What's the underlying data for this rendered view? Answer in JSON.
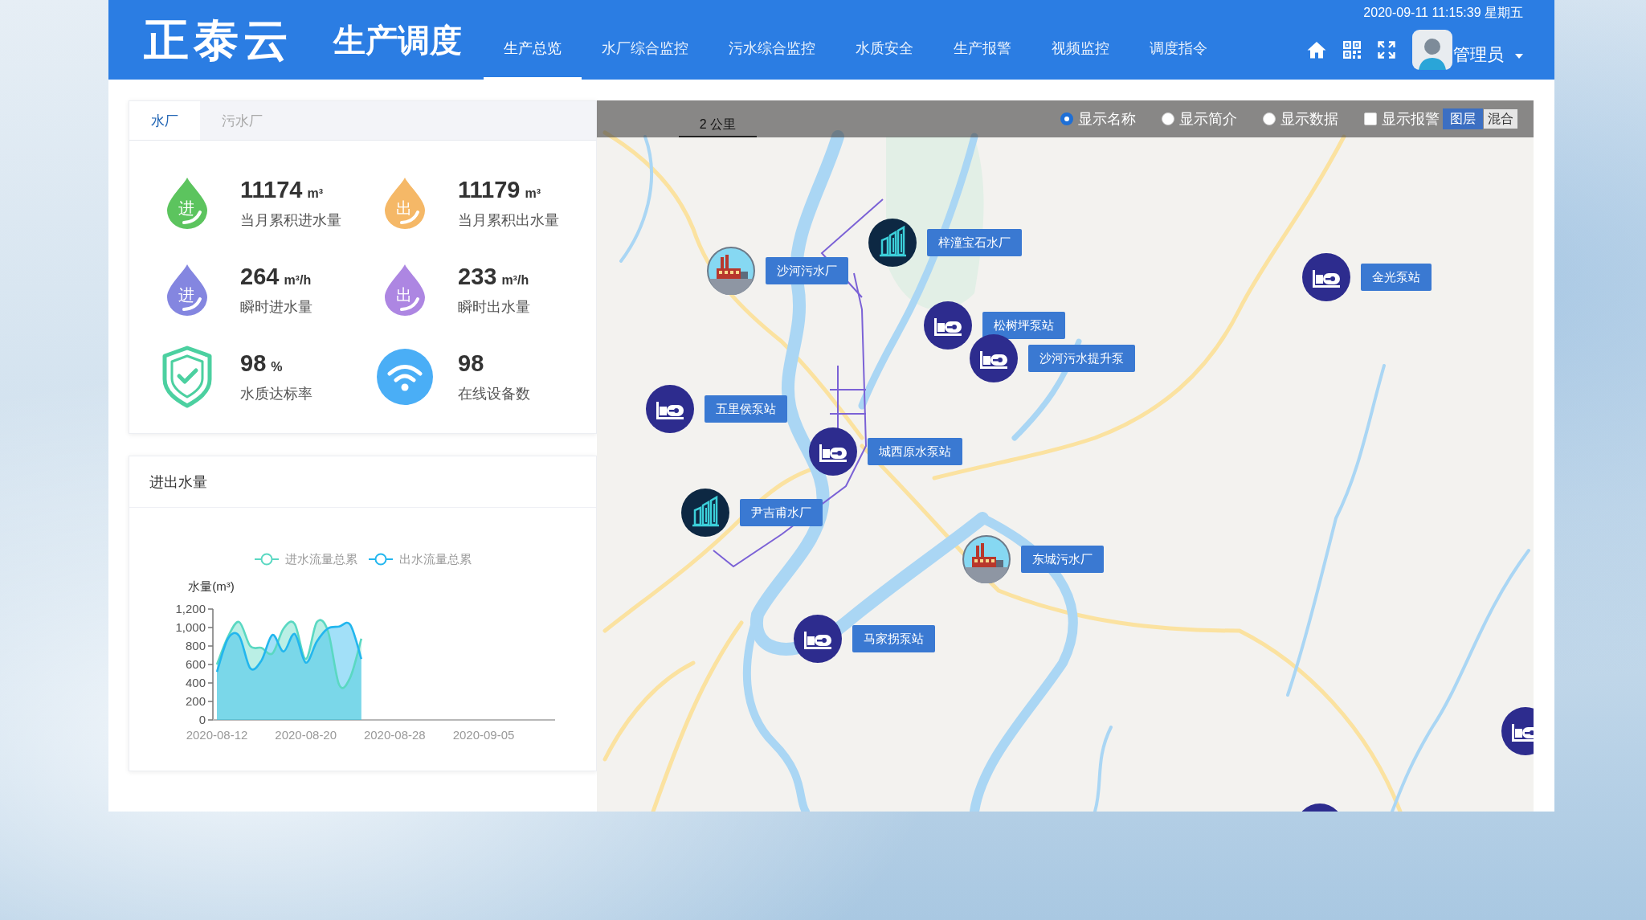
{
  "header": {
    "logo": "正泰云",
    "title": "生产调度",
    "nav": [
      {
        "label": "生产总览",
        "selected": true
      },
      {
        "label": "水厂综合监控",
        "selected": false
      },
      {
        "label": "污水综合监控",
        "selected": false
      },
      {
        "label": "水质安全",
        "selected": false
      },
      {
        "label": "生产报警",
        "selected": false
      },
      {
        "label": "视频监控",
        "selected": false
      },
      {
        "label": "调度指令",
        "selected": false
      }
    ],
    "datetime": "2020-09-11 11:15:39 星期五",
    "user": "管理员"
  },
  "plant_tabs": [
    {
      "label": "水厂",
      "selected": true
    },
    {
      "label": "污水厂",
      "selected": false
    }
  ],
  "stats": [
    {
      "kind": "drop",
      "badge": "进",
      "color": "#5cc45e",
      "value": "11174",
      "unit": "m³",
      "label": "当月累积进水量"
    },
    {
      "kind": "drop",
      "badge": "出",
      "color": "#f5b867",
      "value": "11179",
      "unit": "m³",
      "label": "当月累积出水量"
    },
    {
      "kind": "drop",
      "badge": "进",
      "color": "#8486e0",
      "value": "264",
      "unit": "m³/h",
      "label": "瞬时进水量"
    },
    {
      "kind": "drop",
      "badge": "出",
      "color": "#ad86e2",
      "value": "233",
      "unit": "m³/h",
      "label": "瞬时出水量"
    },
    {
      "kind": "shield",
      "color": "#4cd0a0",
      "value": "98",
      "unit": "%",
      "label": "水质达标率"
    },
    {
      "kind": "wifi",
      "color": "#4aaef6",
      "value": "98",
      "label": "在线设备数"
    }
  ],
  "flow_chart": {
    "title": "进出水量",
    "chart_data": {
      "type": "area",
      "ylabel": "水量(m³)",
      "categories": [
        "2020-08-12",
        null,
        null,
        null,
        null,
        null,
        null,
        null,
        "2020-08-20",
        null,
        null,
        null,
        null,
        null,
        null,
        null,
        "2020-08-28",
        null,
        null,
        null,
        null,
        null,
        null,
        null,
        "2020-09-05",
        null,
        null,
        null,
        null,
        null,
        null
      ],
      "ylim": [
        0,
        1200
      ],
      "yticks": [
        {
          "value": 0,
          "label": "0"
        },
        {
          "value": 200,
          "label": "200"
        },
        {
          "value": 400,
          "label": "400"
        },
        {
          "value": 600,
          "label": "600"
        },
        {
          "value": 800,
          "label": "800"
        },
        {
          "value": 1000,
          "label": "1,000"
        },
        {
          "value": 1200,
          "label": "1,200"
        }
      ],
      "series": [
        {
          "name": "进水流量总累",
          "color": "#5ad8c2",
          "values": [
            600,
            900,
            1060,
            800,
            780,
            720,
            990,
            1040,
            660,
            1060,
            960,
            380,
            460,
            880,
            null,
            null,
            null,
            null,
            null,
            null,
            null,
            null,
            null,
            null,
            null,
            null,
            null,
            null,
            null,
            null,
            null
          ]
        },
        {
          "name": "出水流量总累",
          "color": "#22b6ee",
          "values": [
            520,
            880,
            910,
            560,
            640,
            920,
            740,
            930,
            620,
            850,
            990,
            1010,
            1030,
            660,
            null,
            null,
            null,
            null,
            null,
            null,
            null,
            null,
            null,
            null,
            null,
            null,
            null,
            null,
            null,
            null,
            null
          ]
        }
      ]
    }
  },
  "map": {
    "scale": "2 公里",
    "options": [
      {
        "kind": "radio",
        "label": "显示名称",
        "selected": true
      },
      {
        "kind": "radio",
        "label": "显示简介",
        "selected": false
      },
      {
        "kind": "radio",
        "label": "显示数据",
        "selected": false
      },
      {
        "kind": "checkbox",
        "label": "显示报警",
        "checked": false
      }
    ],
    "layer_buttons": [
      {
        "label": "图层",
        "selected": true
      },
      {
        "label": "混合",
        "selected": false
      }
    ],
    "markers": [
      {
        "kind": "sewage_plant",
        "label": "沙河污水厂"
      },
      {
        "kind": "water_plant",
        "label": "梓潼宝石水厂"
      },
      {
        "kind": "pump_station",
        "label": "松树坪泵站"
      },
      {
        "kind": "pump_station",
        "label": "沙河污水提升泵"
      },
      {
        "kind": "pump_station",
        "label": "金光泵站"
      },
      {
        "kind": "pump_station",
        "label": "五里侯泵站"
      },
      {
        "kind": "pump_station",
        "label": "城西原水泵站"
      },
      {
        "kind": "water_plant",
        "label": "尹吉甫水厂"
      },
      {
        "kind": "sewage_plant",
        "label": "东城污水厂"
      },
      {
        "kind": "pump_station",
        "label": "马家拐泵站"
      },
      {
        "kind": "pump_station"
      },
      {
        "kind": "pump_station"
      }
    ]
  }
}
